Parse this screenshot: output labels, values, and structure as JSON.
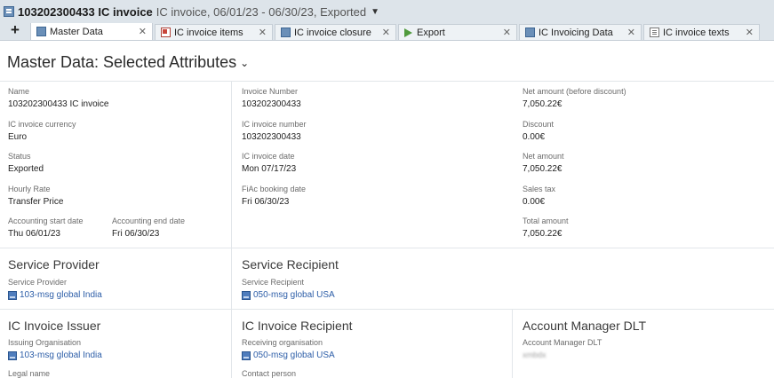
{
  "window": {
    "id": "103202300433 IC invoice",
    "description": "IC invoice, 06/01/23 - 06/30/23, Exported"
  },
  "tabs": [
    {
      "label": "Master Data",
      "active": true,
      "icon": "data-icon"
    },
    {
      "label": "IC invoice items",
      "active": false,
      "icon": "items-icon"
    },
    {
      "label": "IC invoice closure",
      "active": false,
      "icon": "data-icon"
    },
    {
      "label": "Export",
      "active": false,
      "icon": "export-icon"
    },
    {
      "label": "IC Invoicing Data",
      "active": false,
      "icon": "data-icon"
    },
    {
      "label": "IC invoice texts",
      "active": false,
      "icon": "texts-icon"
    }
  ],
  "section": {
    "title": "Master Data: Selected Attributes"
  },
  "master": {
    "name": {
      "label": "Name",
      "value": "103202300433 IC invoice"
    },
    "currency": {
      "label": "IC invoice currency",
      "value": "Euro"
    },
    "status": {
      "label": "Status",
      "value": "Exported"
    },
    "hourly_rate": {
      "label": "Hourly Rate",
      "value": "Transfer Price"
    },
    "acc_start": {
      "label": "Accounting start date",
      "value": "Thu 06/01/23"
    },
    "acc_end": {
      "label": "Accounting end date",
      "value": "Fri 06/30/23"
    },
    "invoice_number": {
      "label": "Invoice Number",
      "value": "103202300433"
    },
    "ic_invoice_number": {
      "label": "IC invoice number",
      "value": "103202300433"
    },
    "ic_invoice_date": {
      "label": "IC invoice date",
      "value": "Mon 07/17/23"
    },
    "fiac_booking": {
      "label": "FiAc booking date",
      "value": "Fri 06/30/23"
    },
    "net_before": {
      "label": "Net amount (before discount)",
      "value": "7,050.22€"
    },
    "discount": {
      "label": "Discount",
      "value": "0.00€"
    },
    "net": {
      "label": "Net amount",
      "value": "7,050.22€"
    },
    "sales_tax": {
      "label": "Sales tax",
      "value": "0.00€"
    },
    "total": {
      "label": "Total amount",
      "value": "7,050.22€"
    }
  },
  "service_provider": {
    "title": "Service Provider",
    "label": "Service Provider",
    "value": "103-msg global India"
  },
  "service_recipient": {
    "title": "Service Recipient",
    "label": "Service Recipient",
    "value": "050-msg global USA"
  },
  "issuer": {
    "title": "IC Invoice Issuer",
    "label": "Issuing Organisation",
    "value": "103-msg global India",
    "legal_label": "Legal name"
  },
  "recipient": {
    "title": "IC Invoice Recipient",
    "label": "Receiving organisation",
    "value": "050-msg global USA",
    "contact_label": "Contact person"
  },
  "account_manager": {
    "title": "Account Manager DLT",
    "label": "Account Manager DLT",
    "value": "xmbdx"
  }
}
